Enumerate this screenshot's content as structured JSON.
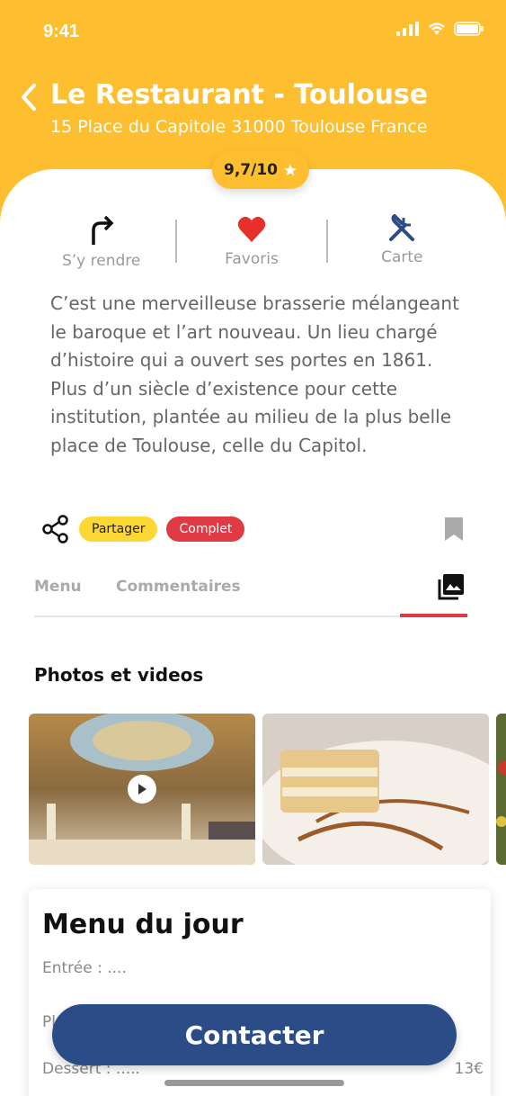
{
  "status": {
    "time": "9:41"
  },
  "header": {
    "title": "Le Restaurant - Toulouse",
    "subtitle": "15 Place du Capitole 31000 Toulouse France",
    "rating": "9,7/10"
  },
  "actions": [
    {
      "label": "S’y rendre",
      "icon": "turn-right-arrow-icon"
    },
    {
      "label": "Favoris",
      "icon": "heart-icon"
    },
    {
      "label": "Carte",
      "icon": "fork-knife-icon"
    }
  ],
  "description": "C’est une merveilleuse brasserie mélangeant le baroque et l’art nouveau. Un lieu chargé d’histoire qui a ouvert ses portes en 1861. Plus d’un siècle d’existence pour cette institution, plantée au milieu de la plus belle place de Toulouse, celle du Capitol.",
  "share": {
    "share_label": "Partager",
    "status_label": "Complet"
  },
  "tabs": [
    {
      "label": "Menu"
    },
    {
      "label": "Commentaires"
    }
  ],
  "gallery": {
    "title": "Photos et videos"
  },
  "menu_du_jour": {
    "title": "Menu du jour",
    "entree": "Entrée : ....",
    "plat": "Pl",
    "dessert": "Dessert : .....",
    "price": "13€"
  },
  "contact_label": "Contacter",
  "colors": {
    "accent": "#FDBE30",
    "primary": "#2C4C87",
    "danger": "#E03A45"
  }
}
